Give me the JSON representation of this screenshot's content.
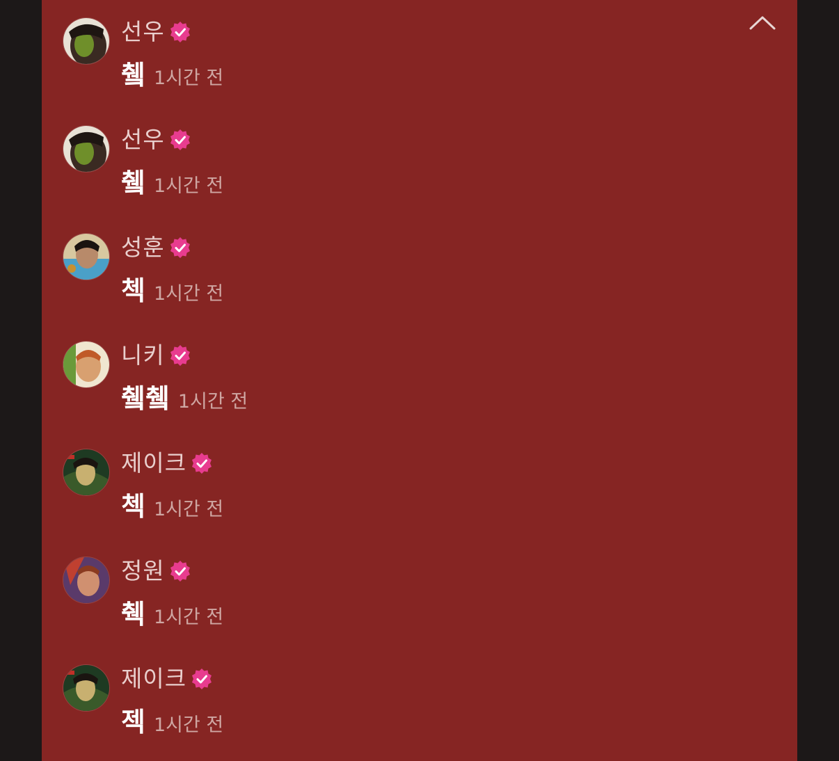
{
  "colors": {
    "panel_bg": "#862523",
    "page_bg": "#1c1818",
    "badge": "#e83c8f",
    "name_text": "#e9cfcd",
    "message_text": "#ffffff",
    "time_text": "#cfa7a3"
  },
  "header": {
    "collapse_icon": "chevron-up-icon"
  },
  "comments": [
    {
      "name": "선우",
      "message": "췤",
      "time": "1시간 전",
      "verified": true,
      "avatar": "avatar-photo"
    },
    {
      "name": "선우",
      "message": "췤",
      "time": "1시간 전",
      "verified": true,
      "avatar": "avatar-photo"
    },
    {
      "name": "성훈",
      "message": "첵",
      "time": "1시간 전",
      "verified": true,
      "avatar": "avatar-photo"
    },
    {
      "name": "니키",
      "message": "췤췤",
      "time": "1시간 전",
      "verified": true,
      "avatar": "avatar-photo"
    },
    {
      "name": "제이크",
      "message": "첵",
      "time": "1시간 전",
      "verified": true,
      "avatar": "avatar-photo"
    },
    {
      "name": "정원",
      "message": "췍",
      "time": "1시간 전",
      "verified": true,
      "avatar": "avatar-photo"
    },
    {
      "name": "제이크",
      "message": "젝",
      "time": "1시간 전",
      "verified": true,
      "avatar": "avatar-photo"
    }
  ]
}
